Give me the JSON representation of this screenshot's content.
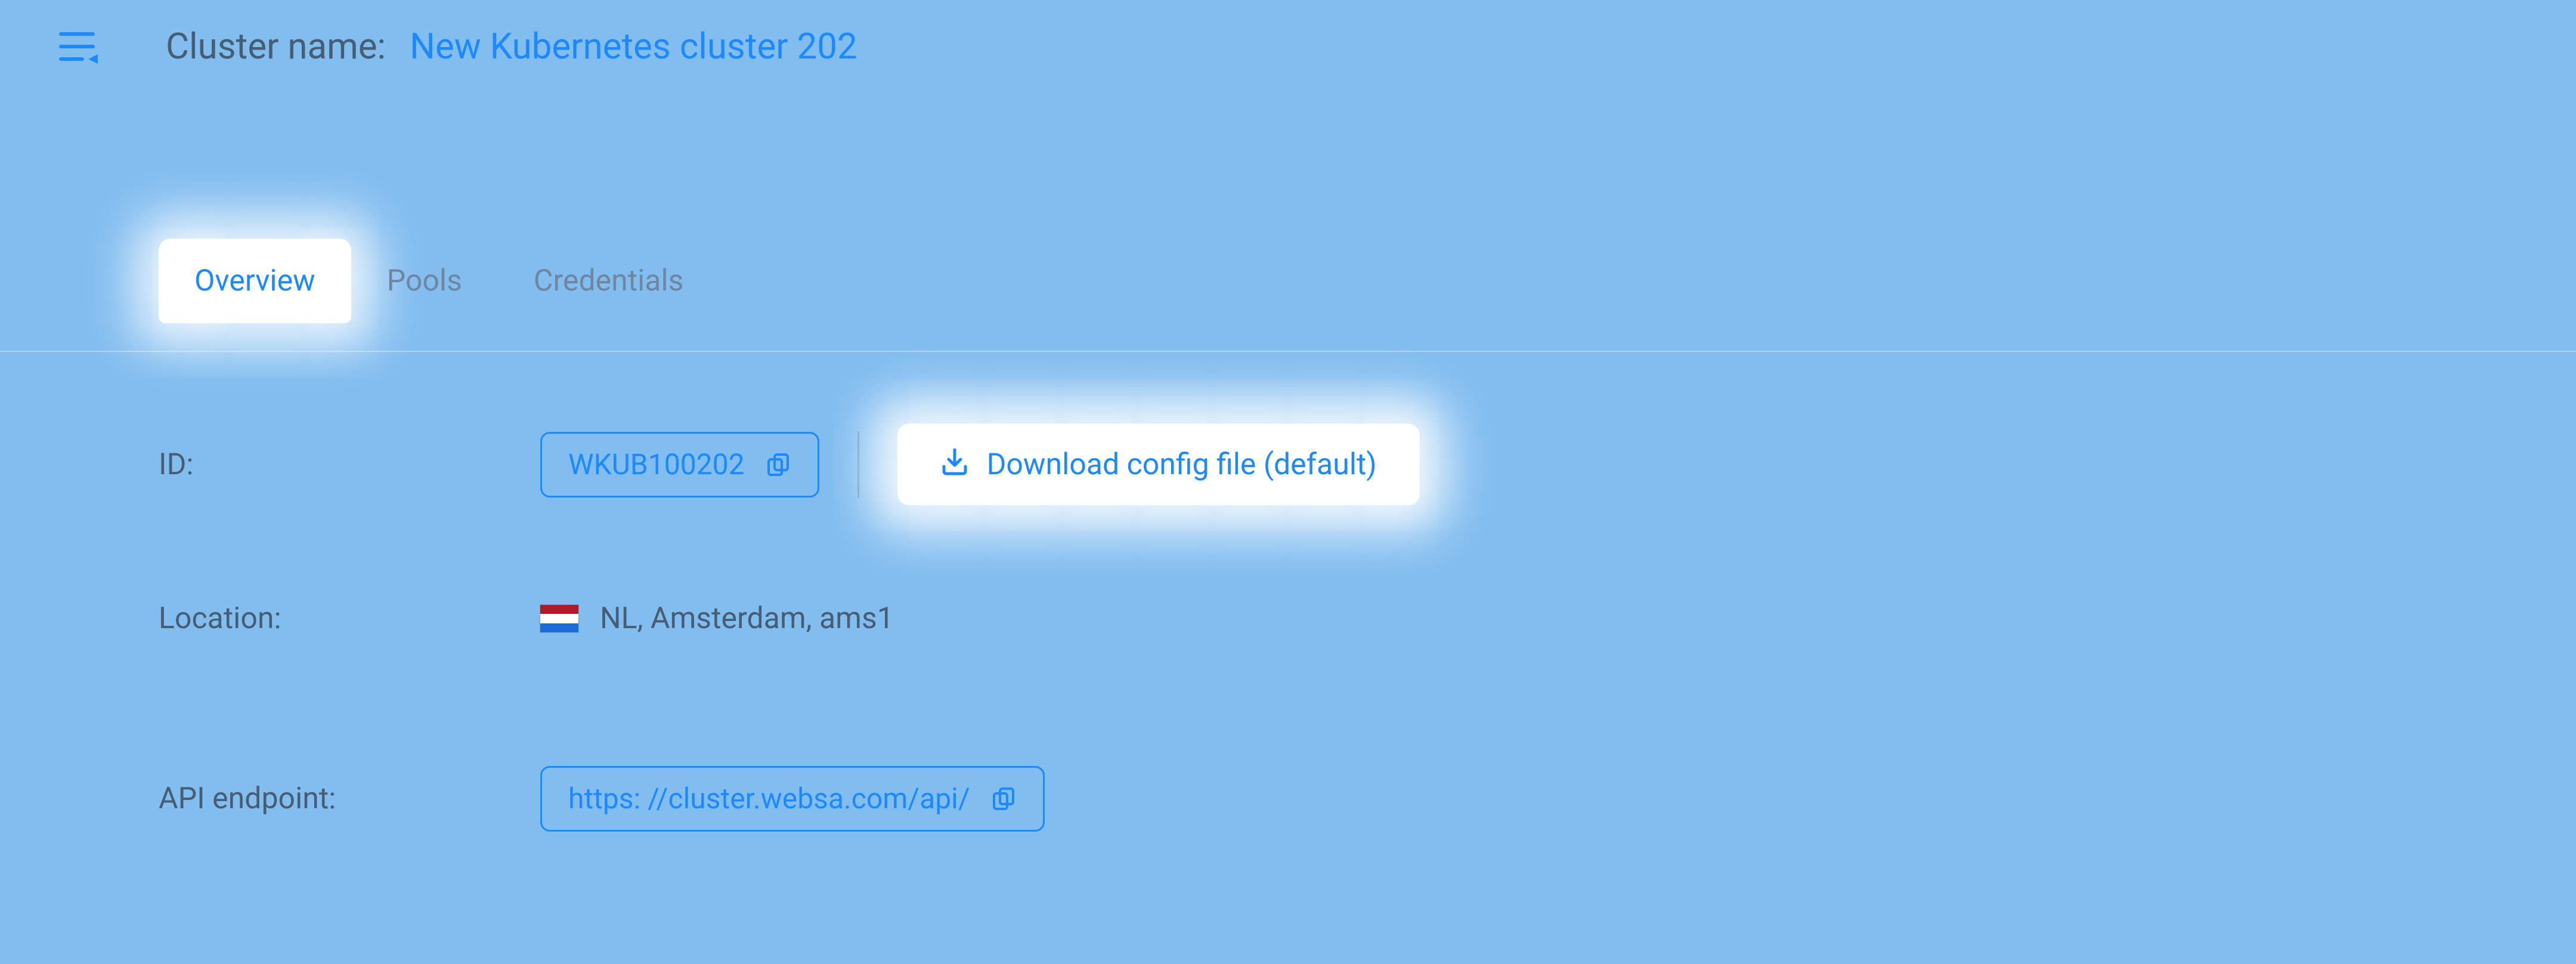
{
  "header": {
    "title_label": "Cluster name:",
    "title_value": "New Kubernetes cluster 202"
  },
  "tabs": {
    "overview": "Overview",
    "pools": "Pools",
    "credentials": "Credentials"
  },
  "overview": {
    "id_label": "ID:",
    "id_value": "WKUB100202",
    "download_label": "Download config file (default)",
    "location_label": "Location:",
    "location_value": "NL, Amsterdam, ams1",
    "api_label": "API endpoint:",
    "api_value": "https: //cluster.websa.com/api/"
  }
}
